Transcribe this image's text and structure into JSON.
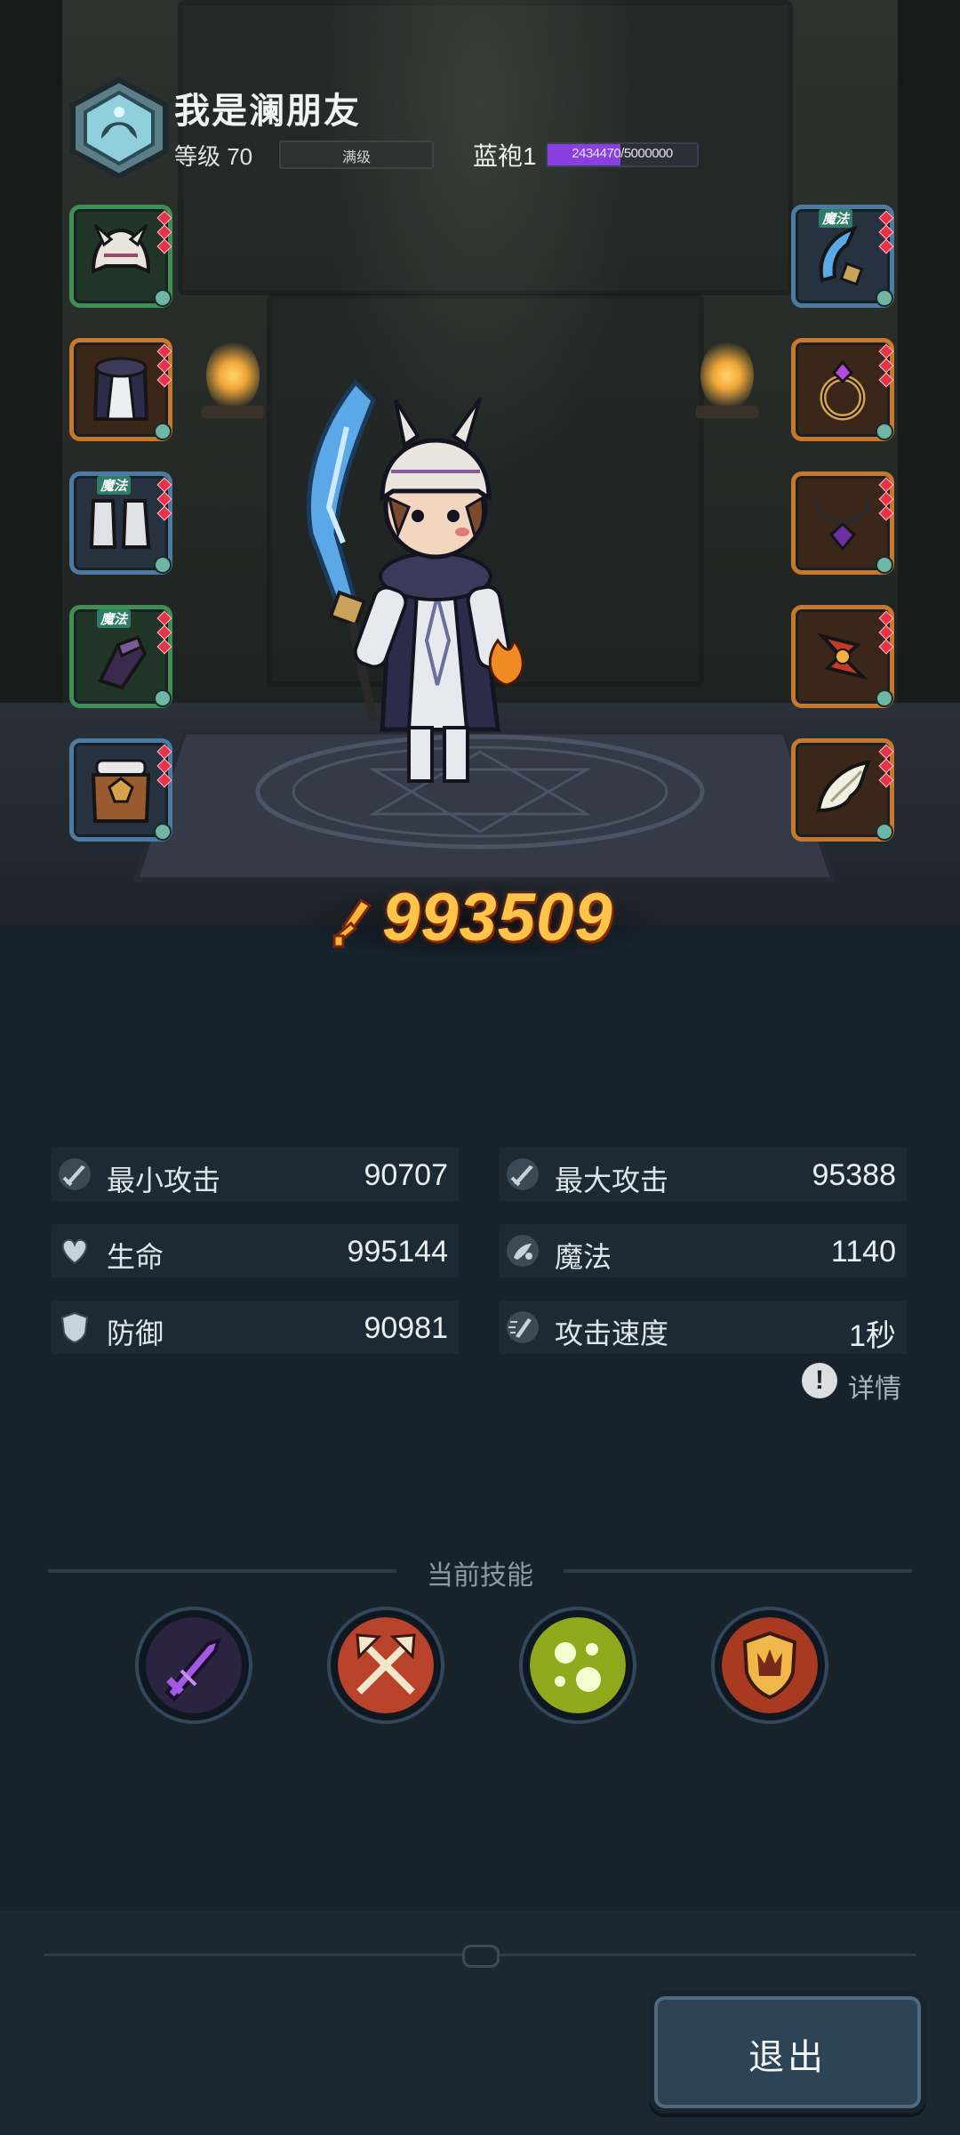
{
  "header": {
    "player_name": "我是澜朋友",
    "level_label": "等级 70",
    "level_bar_text": "满级",
    "rank_label": "蓝袍1",
    "rank_progress_text": "2434470/5000000",
    "rank_progress_fraction": 0.49
  },
  "equipment": {
    "left": [
      {
        "item": "helmet",
        "frame": "green",
        "tag": ""
      },
      {
        "item": "armor",
        "frame": "orange",
        "tag": ""
      },
      {
        "item": "boots",
        "frame": "blue",
        "tag": "魔法"
      },
      {
        "item": "gloves",
        "frame": "green",
        "tag": "魔法"
      },
      {
        "item": "belt",
        "frame": "blue",
        "tag": ""
      }
    ],
    "right": [
      {
        "item": "weapon",
        "frame": "blue",
        "tag": "魔法"
      },
      {
        "item": "ring",
        "frame": "orange",
        "tag": ""
      },
      {
        "item": "necklace",
        "frame": "orange",
        "tag": ""
      },
      {
        "item": "charm",
        "frame": "orange",
        "tag": ""
      },
      {
        "item": "wings",
        "frame": "orange",
        "tag": ""
      }
    ]
  },
  "power": {
    "value": "993509",
    "icon": "sword-power-icon"
  },
  "stats": {
    "min_attack": {
      "label": "最小攻击",
      "value": "90707",
      "icon": "sword-icon"
    },
    "max_attack": {
      "label": "最大攻击",
      "value": "95388",
      "icon": "sword-icon"
    },
    "hp": {
      "label": "生命",
      "value": "995144",
      "icon": "heart-icon"
    },
    "magic": {
      "label": "魔法",
      "value": "1140",
      "icon": "magic-icon"
    },
    "defense": {
      "label": "防御",
      "value": "90981",
      "icon": "shield-icon"
    },
    "attack_speed": {
      "label": "攻击速度",
      "value": "1秒",
      "icon": "speed-icon"
    }
  },
  "details_label": "详情",
  "skills": {
    "title": "当前技能",
    "items": [
      {
        "name": "purple-sword-skill",
        "color": "#7a3fb8"
      },
      {
        "name": "crossed-axes-skill",
        "color": "#b9432a"
      },
      {
        "name": "poison-bubbles-skill",
        "color": "#8fa81c"
      },
      {
        "name": "shield-crest-skill",
        "color": "#a93a22"
      }
    ]
  },
  "exit_label": "退出",
  "colors": {
    "background": "#17222b",
    "power_gold": "#ffc44a",
    "rank_purple": "#8a3fe0"
  }
}
